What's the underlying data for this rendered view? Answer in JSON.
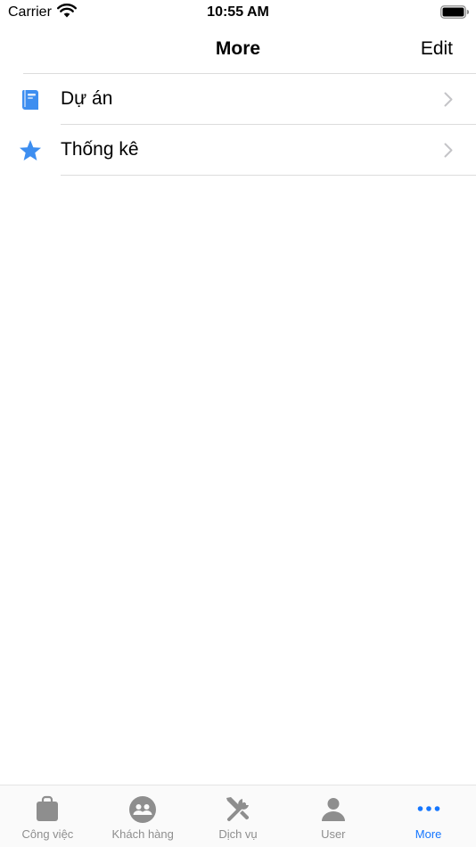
{
  "status_bar": {
    "carrier": "Carrier",
    "time": "10:55 AM"
  },
  "nav": {
    "title": "More",
    "edit_label": "Edit"
  },
  "list": {
    "items": [
      {
        "label": "Dự án",
        "icon": "book-icon"
      },
      {
        "label": "Thống kê",
        "icon": "star-icon"
      }
    ]
  },
  "tab_bar": {
    "active_index": 4,
    "tabs": [
      {
        "label": "Công việc",
        "icon": "briefcase-icon"
      },
      {
        "label": "Khách hàng",
        "icon": "people-icon"
      },
      {
        "label": "Dịch vụ",
        "icon": "tools-icon"
      },
      {
        "label": "User",
        "icon": "person-icon"
      },
      {
        "label": "More",
        "icon": "ellipsis-icon"
      }
    ]
  },
  "colors": {
    "accent": "#1677ff",
    "icon_blue": "#3d8ef0",
    "inactive": "#8e8e8e",
    "separator": "#dcdcdc"
  }
}
